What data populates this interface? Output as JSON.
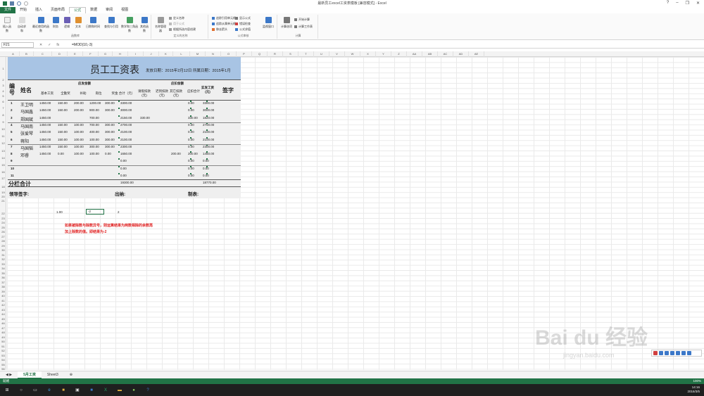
{
  "window": {
    "title": "最新员工excel工资表模板 [兼容模式] - Excel"
  },
  "tabs": [
    "文件",
    "开始",
    "插入",
    "页面布局",
    "公式",
    "数据",
    "审阅",
    "视图"
  ],
  "ribbon": {
    "buttons": [
      "插入函数",
      "自动求和",
      "最近使用的函数",
      "财务",
      "逻辑",
      "文本",
      "日期和时间",
      "查找与引用",
      "数学和三角函数",
      "其他函数",
      "名称管理器",
      "监视窗口",
      "计算选项"
    ],
    "small": [
      "定义名称",
      "用于公式",
      "根据所选内容创建",
      "追踪引用单元格",
      "追踪从属单元格",
      "移去箭头",
      "显示公式",
      "错误检查",
      "公式求值",
      "开始计算",
      "计算工作表"
    ],
    "groups": [
      "函数库",
      "定义的名称",
      "公式审核",
      "计算"
    ]
  },
  "formula_bar": {
    "name_box": "F21",
    "formula": "=MOD(10,-3)"
  },
  "columns": [
    "A",
    "B",
    "C",
    "D",
    "E",
    "F",
    "G",
    "H",
    "I",
    "J",
    "K",
    "L",
    "M",
    "N",
    "O",
    "P",
    "Q",
    "R",
    "S",
    "T",
    "U",
    "V",
    "W",
    "X",
    "Y",
    "Z",
    "AA",
    "AB",
    "AC",
    "AD",
    "AE"
  ],
  "sheet": {
    "title": "员工工资表",
    "date_line": "发放日期：2015年2月12日 所属日期：2015年1月",
    "h_no": "编号",
    "h_name": "姓名",
    "h_pay": "应发金额",
    "h_ded": "应扣金额",
    "h_sign": "签字",
    "h_net": "实发工资(元)",
    "sub_headers": [
      "基本工资",
      "全勤奖",
      "补助",
      "岗位",
      "奖金",
      "合计（元）",
      "请假扣款(元)",
      "迟到扣款(元)",
      "其它扣款(元)",
      "应扣合计"
    ],
    "rows": [
      {
        "no": "1",
        "name": "王卫明",
        "v": [
          "1450.00",
          "150.00",
          "200.00",
          "1200.00",
          "300.00",
          "3300.00",
          "",
          "",
          "",
          "0.00",
          "3300.00"
        ]
      },
      {
        "no": "2",
        "name": "马国鑫",
        "v": [
          "1450.00",
          "150.00",
          "200.00",
          "900.00",
          "300.00",
          "3000.00",
          "",
          "",
          "",
          "0.00",
          "3000.00"
        ]
      },
      {
        "no": "3",
        "name": "郑国斌",
        "v": [
          "1450.00",
          "",
          "",
          "700.00",
          "",
          "2150.00",
          "330.00",
          "",
          "",
          "330.00",
          "1820.00"
        ]
      },
      {
        "no": "4",
        "name": "马国南",
        "v": [
          "1450.00",
          "150.00",
          "100.00",
          "700.00",
          "300.00",
          "2700.00",
          "",
          "",
          "",
          "0.00",
          "2700.00"
        ]
      },
      {
        "no": "5",
        "name": "张爱琴",
        "v": [
          "1450.00",
          "150.00",
          "100.00",
          "400.00",
          "300.00",
          "2100.00",
          "",
          "",
          "",
          "0.00",
          "2100.00"
        ]
      },
      {
        "no": "6",
        "name": "蒋阳",
        "v": [
          "1450.00",
          "150.00",
          "100.00",
          "100.00",
          "300.00",
          "2100.00",
          "",
          "",
          "",
          "0.00",
          "2100.00"
        ]
      },
      {
        "no": "7",
        "name": "马国韬",
        "v": [
          "1450.00",
          "150.00",
          "100.00",
          "300.00",
          "300.00",
          "2300.00",
          "",
          "",
          "",
          "0.00",
          "2300.00"
        ]
      },
      {
        "no": "8",
        "name": "邓睿",
        "v": [
          "1450.00",
          "0.00",
          "100.00",
          "100.00",
          "0.00",
          "1650.00",
          "",
          "",
          "200.00",
          "200.00",
          "1450.00"
        ]
      },
      {
        "no": "9",
        "name": "",
        "v": [
          "",
          "",
          "",
          "",
          "",
          "0.00",
          "",
          "",
          "",
          "0.00",
          "0.00"
        ]
      },
      {
        "no": "10",
        "name": "",
        "v": [
          "",
          "",
          "",
          "",
          "",
          "0.00",
          "",
          "",
          "",
          "0.00",
          "0.00"
        ]
      },
      {
        "no": "11",
        "name": "",
        "v": [
          "",
          "",
          "",
          "",
          "",
          "0.00",
          "",
          "",
          "",
          "0.00",
          "0.00"
        ]
      }
    ],
    "total_label": "分栏合计",
    "total_sum": "19300.00",
    "total_net": "18770.00",
    "leader_sign": "领导签字:",
    "cashier": "出纳:",
    "maker": "制表:"
  },
  "calc": {
    "c21": "1.00",
    "f21": "-2",
    "h21": "2",
    "note1": "如果被除数与除数异号，则运算结果为两数相除的余数再",
    "note2": "加上除数的值。即结果为-2"
  },
  "sheet_tabs": [
    "5月工资",
    "Sheet3"
  ],
  "status": {
    "ready": "就绪",
    "zoom": "100%"
  },
  "clock": {
    "time": "14:16",
    "date": "2016/3/5"
  },
  "watermark": {
    "brand": "Bai du 经验",
    "url": "jingyan.baidu.com"
  }
}
